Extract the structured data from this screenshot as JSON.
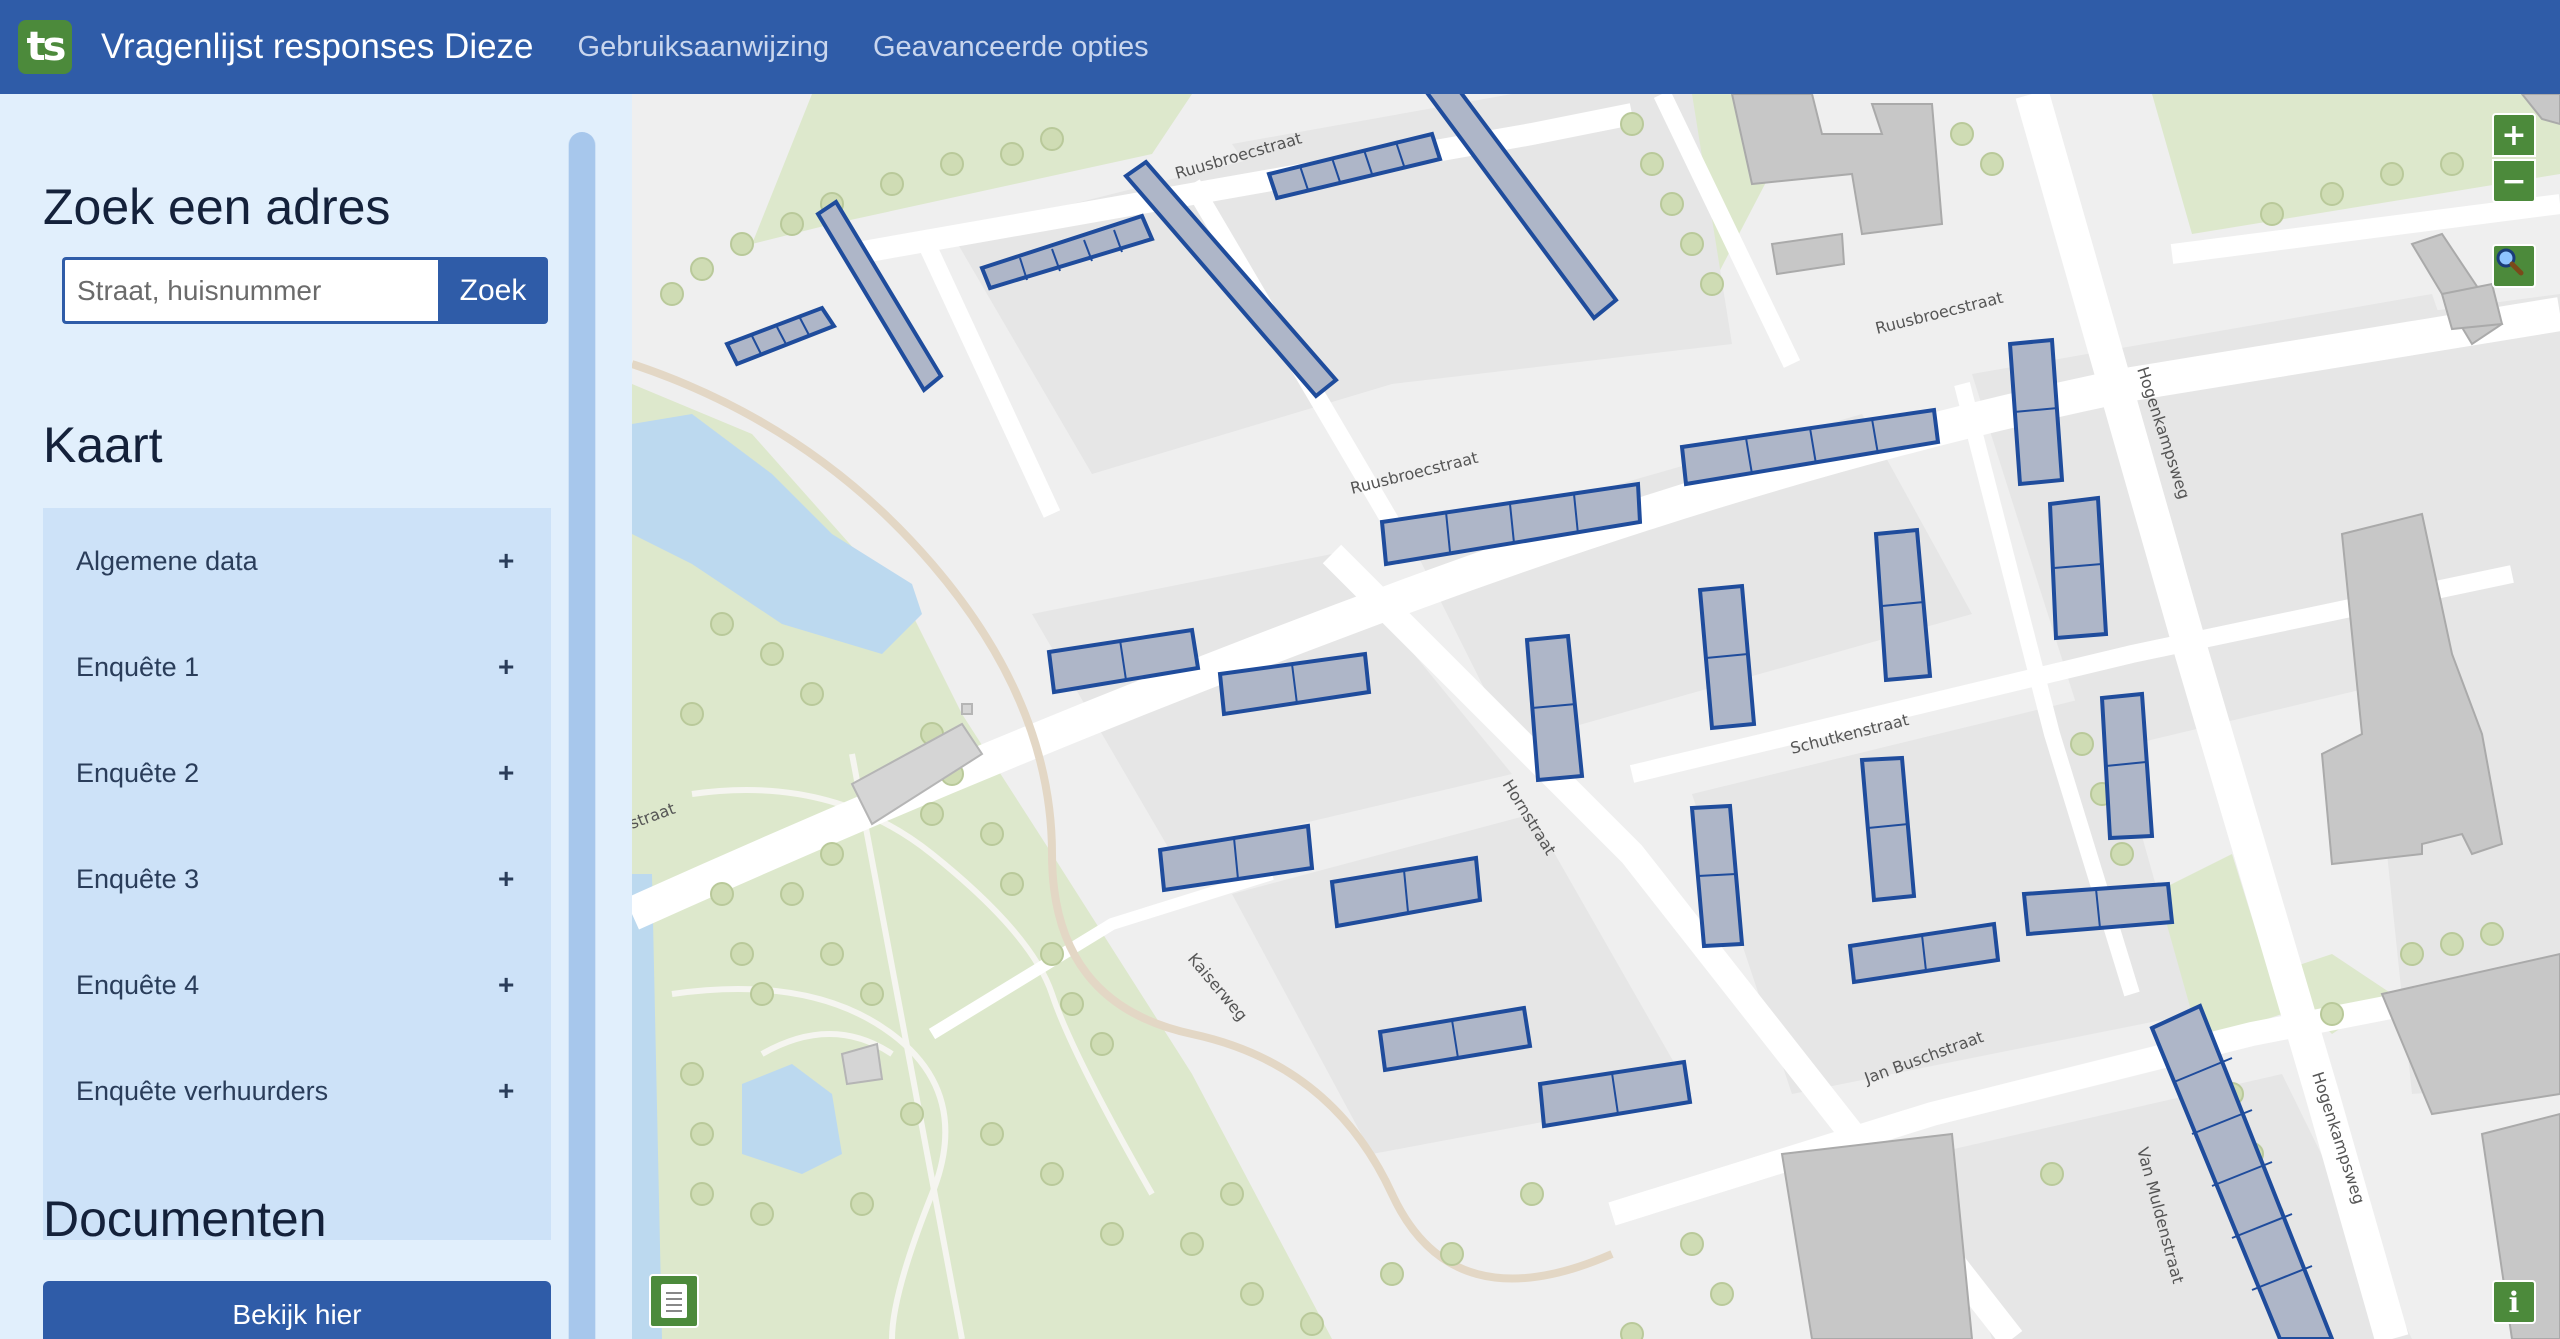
{
  "navbar": {
    "logo_text": "ts",
    "title": "Vragenlijst responses Dieze",
    "links": [
      "Gebruiksaanwijzing",
      "Geavanceerde opties"
    ]
  },
  "sidebar": {
    "search": {
      "heading": "Zoek een adres",
      "placeholder": "Straat, huisnummer",
      "button": "Zoek"
    },
    "map_section": {
      "heading": "Kaart",
      "items": [
        {
          "label": "Algemene data",
          "icon": "+"
        },
        {
          "label": "Enquête 1",
          "icon": "+"
        },
        {
          "label": "Enquête 2",
          "icon": "+"
        },
        {
          "label": "Enquête 3",
          "icon": "+"
        },
        {
          "label": "Enquête 4",
          "icon": "+"
        },
        {
          "label": "Enquête verhuurders",
          "icon": "+"
        }
      ]
    },
    "documents": {
      "heading": "Documenten",
      "button": "Bekijk hier"
    }
  },
  "map": {
    "controls": {
      "zoom_in": "+",
      "zoom_out": "−",
      "search_icon": "magnifier-icon",
      "info": "i",
      "legend_icon": "document-icon"
    },
    "streets": [
      "Ruusbroecstraat",
      "Ruusbroecstraat",
      "Ruusbroecstraat",
      "Hogenkampsweg",
      "Schutkenstraat",
      "Hornstraat",
      "Kaiserweg",
      "Jan Buschstraat",
      "Van Muldenstraat",
      "Hogenkampsweg",
      "straat"
    ],
    "colors": {
      "header": "#2f5ca8",
      "building_fill": "#aeb6c8",
      "building_stroke": "#1f4c9c",
      "park": "#dde8cc",
      "water": "#bcd9ef",
      "control": "#4c8a3b"
    }
  }
}
